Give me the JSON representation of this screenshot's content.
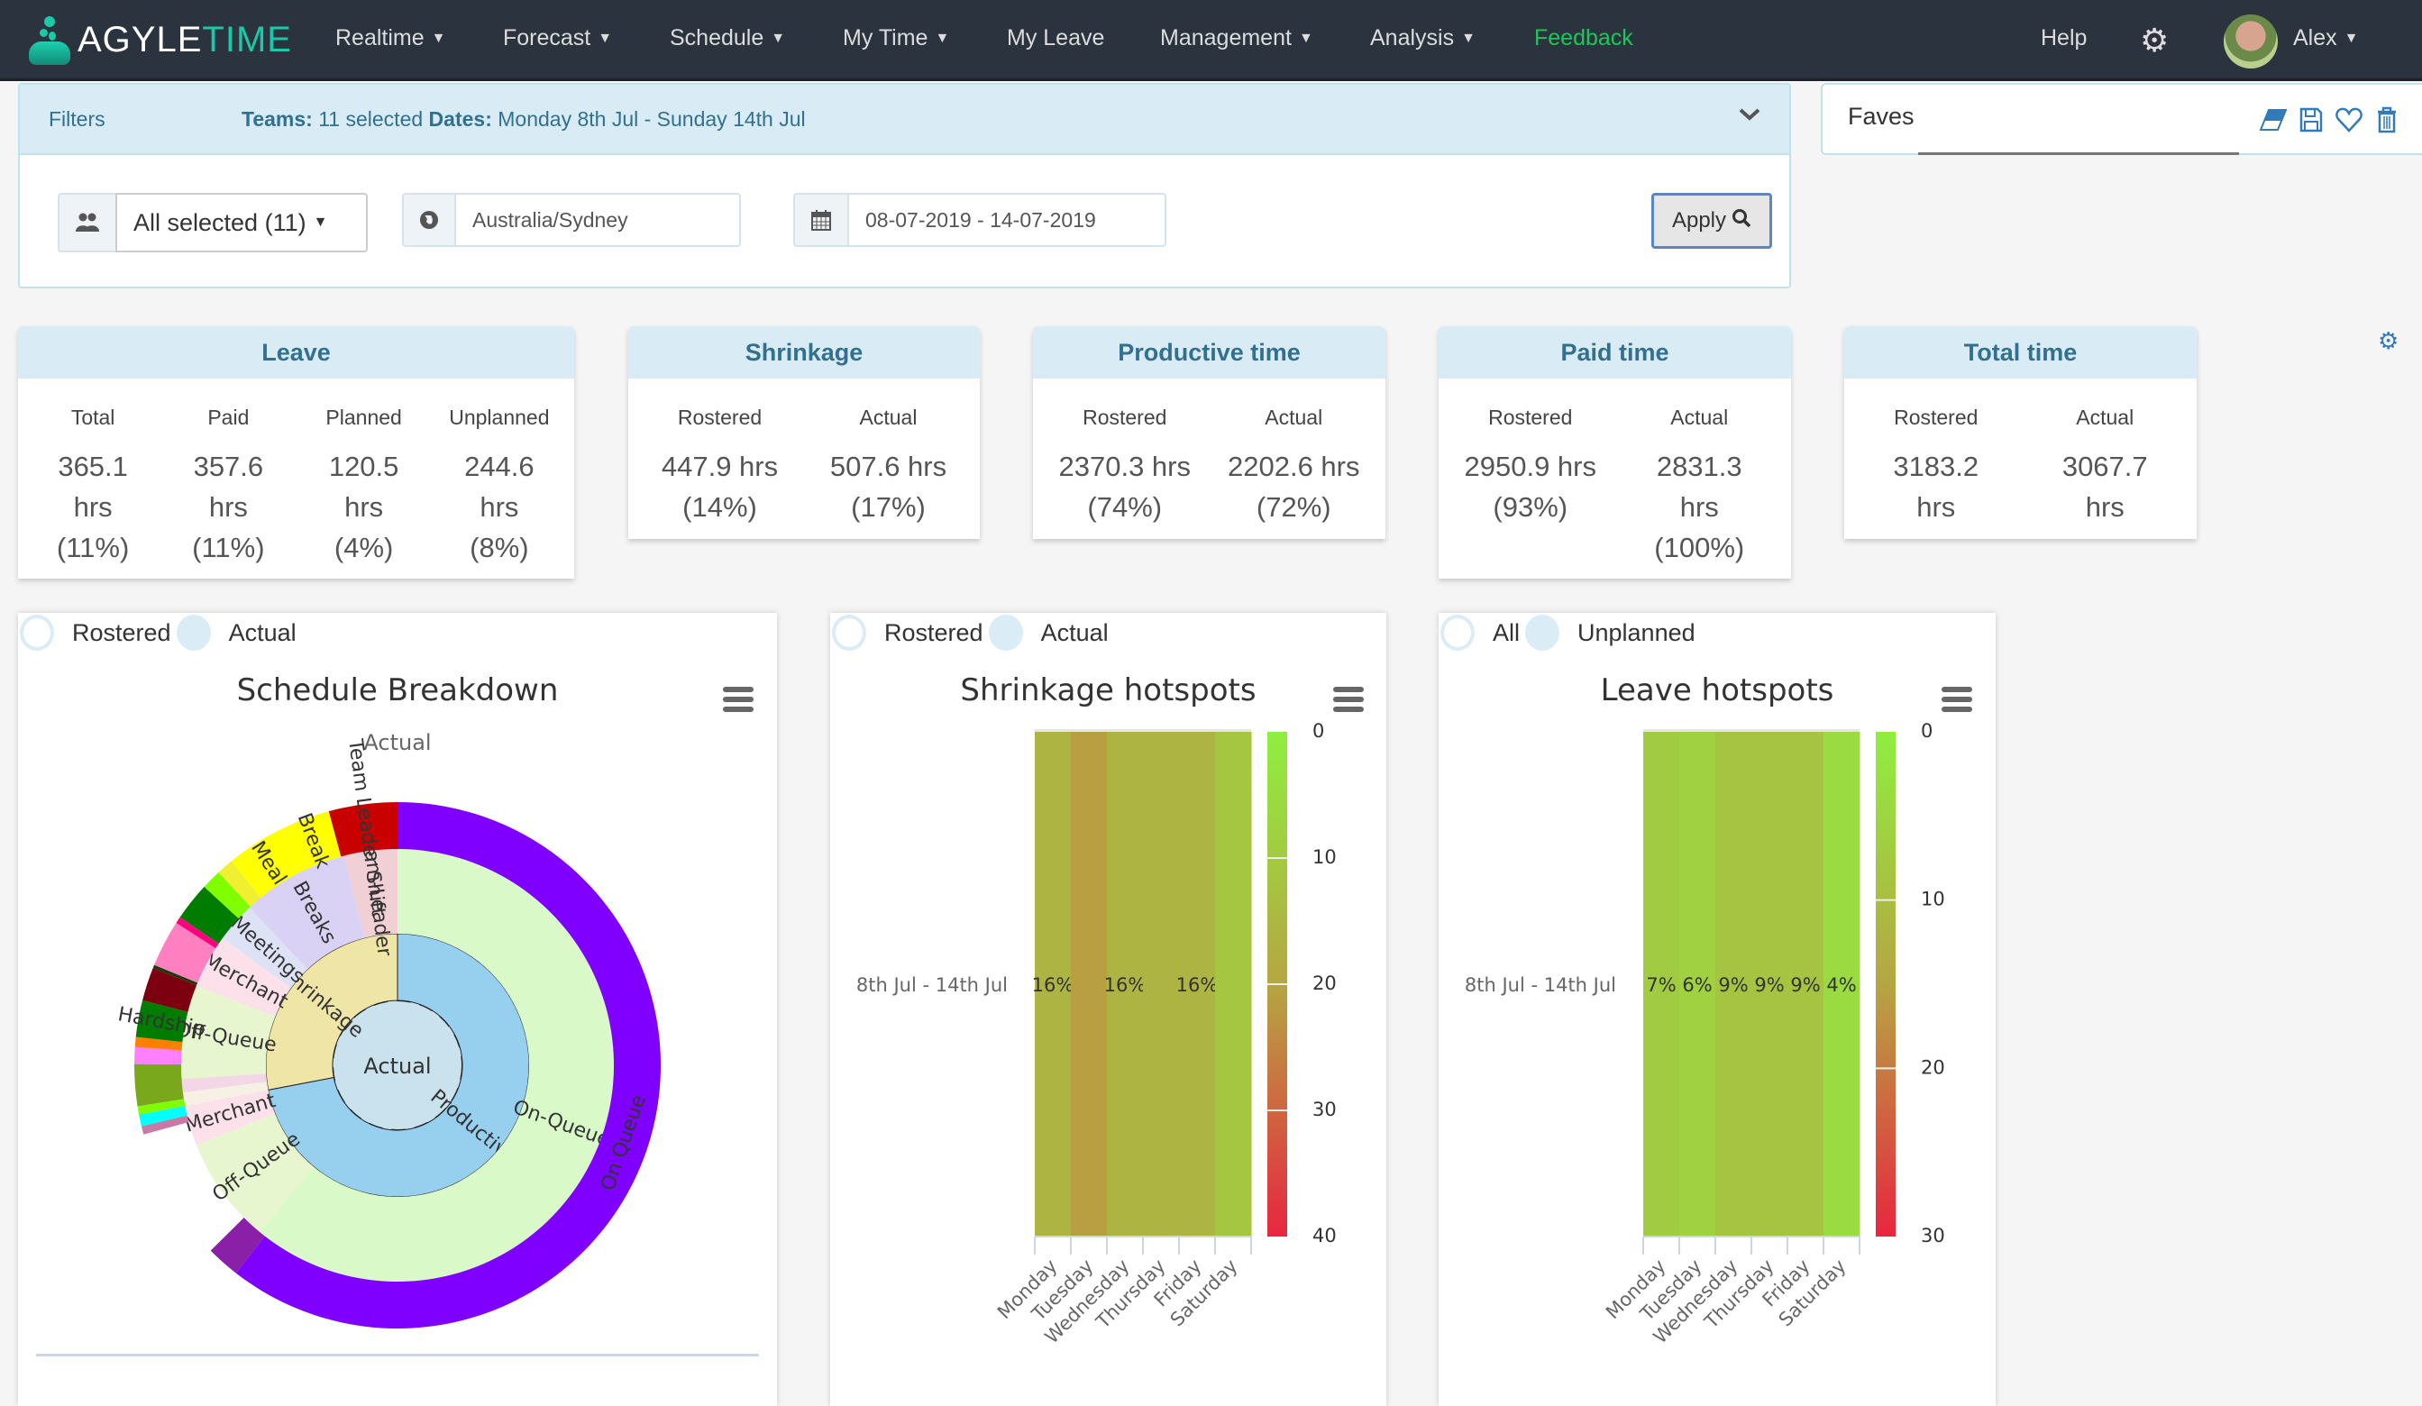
{
  "navbar": {
    "brand_first": "AGYLE",
    "brand_second": "TIME",
    "items": [
      {
        "label": "Realtime",
        "dropdown": true
      },
      {
        "label": "Forecast",
        "dropdown": true
      },
      {
        "label": "Schedule",
        "dropdown": true
      },
      {
        "label": "My Time",
        "dropdown": true
      },
      {
        "label": "My Leave",
        "dropdown": false
      },
      {
        "label": "Management",
        "dropdown": true
      },
      {
        "label": "Analysis",
        "dropdown": true
      },
      {
        "label": "Feedback",
        "dropdown": false
      }
    ],
    "help": "Help",
    "settings_icon": "gear-icon",
    "user": "Alex",
    "caret": "▼"
  },
  "filters": {
    "title": "Filters",
    "teams_label": "Teams:",
    "teams_value": "11 selected",
    "dates_label": "Dates:",
    "dates_value": "Monday 8th Jul - Sunday 14th Jul",
    "teams_select": "All selected (11)",
    "timezone": "Australia/Sydney",
    "date_range": "08-07-2019 - 14-07-2019",
    "apply": "Apply"
  },
  "faves": {
    "label": "Faves",
    "input_value": "",
    "icons": [
      "eraser-icon",
      "save-icon",
      "heart-icon",
      "trash-icon"
    ]
  },
  "stats": [
    {
      "title": "Leave",
      "cols": [
        {
          "label": "Total",
          "value": "365.1 hrs (11%)"
        },
        {
          "label": "Paid",
          "value": "357.6 hrs (11%)"
        },
        {
          "label": "Planned",
          "value": "120.5 hrs (4%)"
        },
        {
          "label": "Unplanned",
          "value": "244.6 hrs (8%)"
        }
      ]
    },
    {
      "title": "Shrinkage",
      "cols": [
        {
          "label": "Rostered",
          "value": "447.9 hrs (14%)"
        },
        {
          "label": "Actual",
          "value": "507.6 hrs (17%)"
        }
      ]
    },
    {
      "title": "Productive time",
      "cols": [
        {
          "label": "Rostered",
          "value": "2370.3 hrs (74%)"
        },
        {
          "label": "Actual",
          "value": "2202.6 hrs (72%)"
        }
      ]
    },
    {
      "title": "Paid time",
      "cols": [
        {
          "label": "Rostered",
          "value": "2950.9 hrs (93%)"
        },
        {
          "label": "Actual",
          "value": "2831.3 hrs (100%)"
        }
      ]
    },
    {
      "title": "Total time",
      "cols": [
        {
          "label": "Rostered",
          "value": "3183.2 hrs"
        },
        {
          "label": "Actual",
          "value": "3067.7 hrs"
        }
      ]
    }
  ],
  "toggles": {
    "schedule": [
      {
        "label": "Rostered",
        "selected": false
      },
      {
        "label": "Actual",
        "selected": true
      }
    ],
    "shrinkage": [
      {
        "label": "Rostered",
        "selected": false
      },
      {
        "label": "Actual",
        "selected": true
      }
    ],
    "leave": [
      {
        "label": "All",
        "selected": false
      },
      {
        "label": "Unplanned",
        "selected": true
      }
    ]
  },
  "chart_data": [
    {
      "type": "sunburst",
      "title": "Schedule Breakdown",
      "subtitle": "Actual",
      "center": "Actual",
      "rings": [
        [
          {
            "label": "Productive",
            "value": 72,
            "color": "#97cfee"
          },
          {
            "label": "Shrinkage",
            "value": 28,
            "color": "#efe5a6"
          }
        ],
        [
          {
            "label": "On-Queue",
            "value": 61,
            "color": "#d9f9c8"
          },
          {
            "label": "Off-Queue",
            "value": 8,
            "color": "#e8f6cf"
          },
          {
            "label": "Merchant",
            "value": 3,
            "color": "#fce0ea"
          },
          {
            "label": "",
            "value": 1,
            "color": "#f6f1e4"
          },
          {
            "label": "",
            "value": 1,
            "color": "#f3d7e6"
          },
          {
            "label": "Off-Queue",
            "value": 7,
            "color": "#e8f6cf"
          },
          {
            "label": "Merchant",
            "value": 4,
            "color": "#fce0ea"
          },
          {
            "label": "Meetings",
            "value": 3,
            "color": "#dde2f7"
          },
          {
            "label": "Breaks",
            "value": 8,
            "color": "#d9d2f5"
          },
          {
            "label": "Team-Leader",
            "value": 4,
            "color": "#f0cfd5"
          }
        ],
        [
          {
            "label": "On Queue",
            "value": 59,
            "color": "#8000ff"
          },
          {
            "label": "",
            "value": 2,
            "color": "#8a1fa8"
          },
          {
            "label": "",
            "value": 8,
            "color": "#ffffff"
          },
          {
            "label": "",
            "value": 0.5,
            "color": "#c87aa6"
          },
          {
            "label": "",
            "value": 0.7,
            "color": "#00ffff"
          },
          {
            "label": "",
            "value": 0.5,
            "color": "#80ff00"
          },
          {
            "label": "",
            "value": 2.5,
            "color": "#7aa81c"
          },
          {
            "label": "",
            "value": 1,
            "color": "#ff80ff"
          },
          {
            "label": "",
            "value": 0.6,
            "color": "#ff8000"
          },
          {
            "label": "Hardship",
            "value": 2.2,
            "color": "#007d00"
          },
          {
            "label": "",
            "value": 2,
            "color": "#7d0010"
          },
          {
            "label": "",
            "value": 0.2,
            "color": "#1d3a0a"
          },
          {
            "label": "",
            "value": 2.8,
            "color": "#ff80c0"
          },
          {
            "label": "",
            "value": 0.4,
            "color": "#ff0080"
          },
          {
            "label": "",
            "value": 2.3,
            "color": "#007d00"
          },
          {
            "label": "",
            "value": 1.2,
            "color": "#80ff00"
          },
          {
            "label": "",
            "value": 1,
            "color": "#f0f030"
          },
          {
            "label": "Meal",
            "value": 3.5,
            "color": "#ffff00"
          },
          {
            "label": "Break",
            "value": 3,
            "color": "#ffff00"
          },
          {
            "label": "Team Leader Shift",
            "value": 4.1,
            "color": "#c80000"
          }
        ]
      ]
    },
    {
      "type": "heatmap",
      "title": "Shrinkage hotspots",
      "row_labels": [
        "8th Jul - 14th Jul"
      ],
      "categories": [
        "Monday",
        "Tuesday",
        "Wednesday",
        "Thursday",
        "Friday",
        "Saturday"
      ],
      "values": [
        16,
        21,
        16,
        16,
        16,
        11
      ],
      "data_labels": [
        "16%",
        "",
        "16%",
        "",
        "16%",
        ""
      ],
      "colorAxis": {
        "min": 0,
        "max": 40,
        "ticks": [
          0,
          10,
          20,
          30,
          40
        ],
        "minColor": "#90ee40",
        "maxColor": "#e8263f"
      }
    },
    {
      "type": "heatmap",
      "title": "Leave hotspots",
      "row_labels": [
        "8th Jul - 14th Jul"
      ],
      "categories": [
        "Monday",
        "Tuesday",
        "Wednesday",
        "Thursday",
        "Friday",
        "Saturday"
      ],
      "values": [
        7,
        6,
        9,
        9,
        9,
        4
      ],
      "data_labels": [
        "7%",
        "6%",
        "9%",
        "9%",
        "9%",
        "4%"
      ],
      "colorAxis": {
        "min": 0,
        "max": 30,
        "ticks": [
          0,
          10,
          20,
          30
        ],
        "minColor": "#90ee40",
        "maxColor": "#e8263f"
      }
    }
  ]
}
